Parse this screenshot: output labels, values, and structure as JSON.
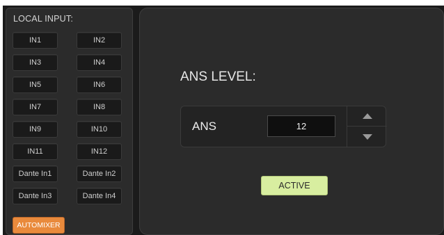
{
  "local_input": {
    "title": "LOCAL INPUT:",
    "buttons": [
      "IN1",
      "IN2",
      "IN3",
      "IN4",
      "IN5",
      "IN6",
      "IN7",
      "IN8",
      "IN9",
      "IN10",
      "IN11",
      "IN12",
      "Dante In1",
      "Dante In2",
      "Dante In3",
      "Dante In4"
    ],
    "automixer": "AUTOMIXER"
  },
  "ans": {
    "title": "ANS LEVEL:",
    "label": "ANS",
    "value": "12",
    "active": "ACTIVE"
  },
  "colors": {
    "automixer_bg": "#e98a3c",
    "active_bg": "#d8eea0",
    "panel_bg": "#2b2b2b",
    "button_bg": "#1a1a1a"
  }
}
